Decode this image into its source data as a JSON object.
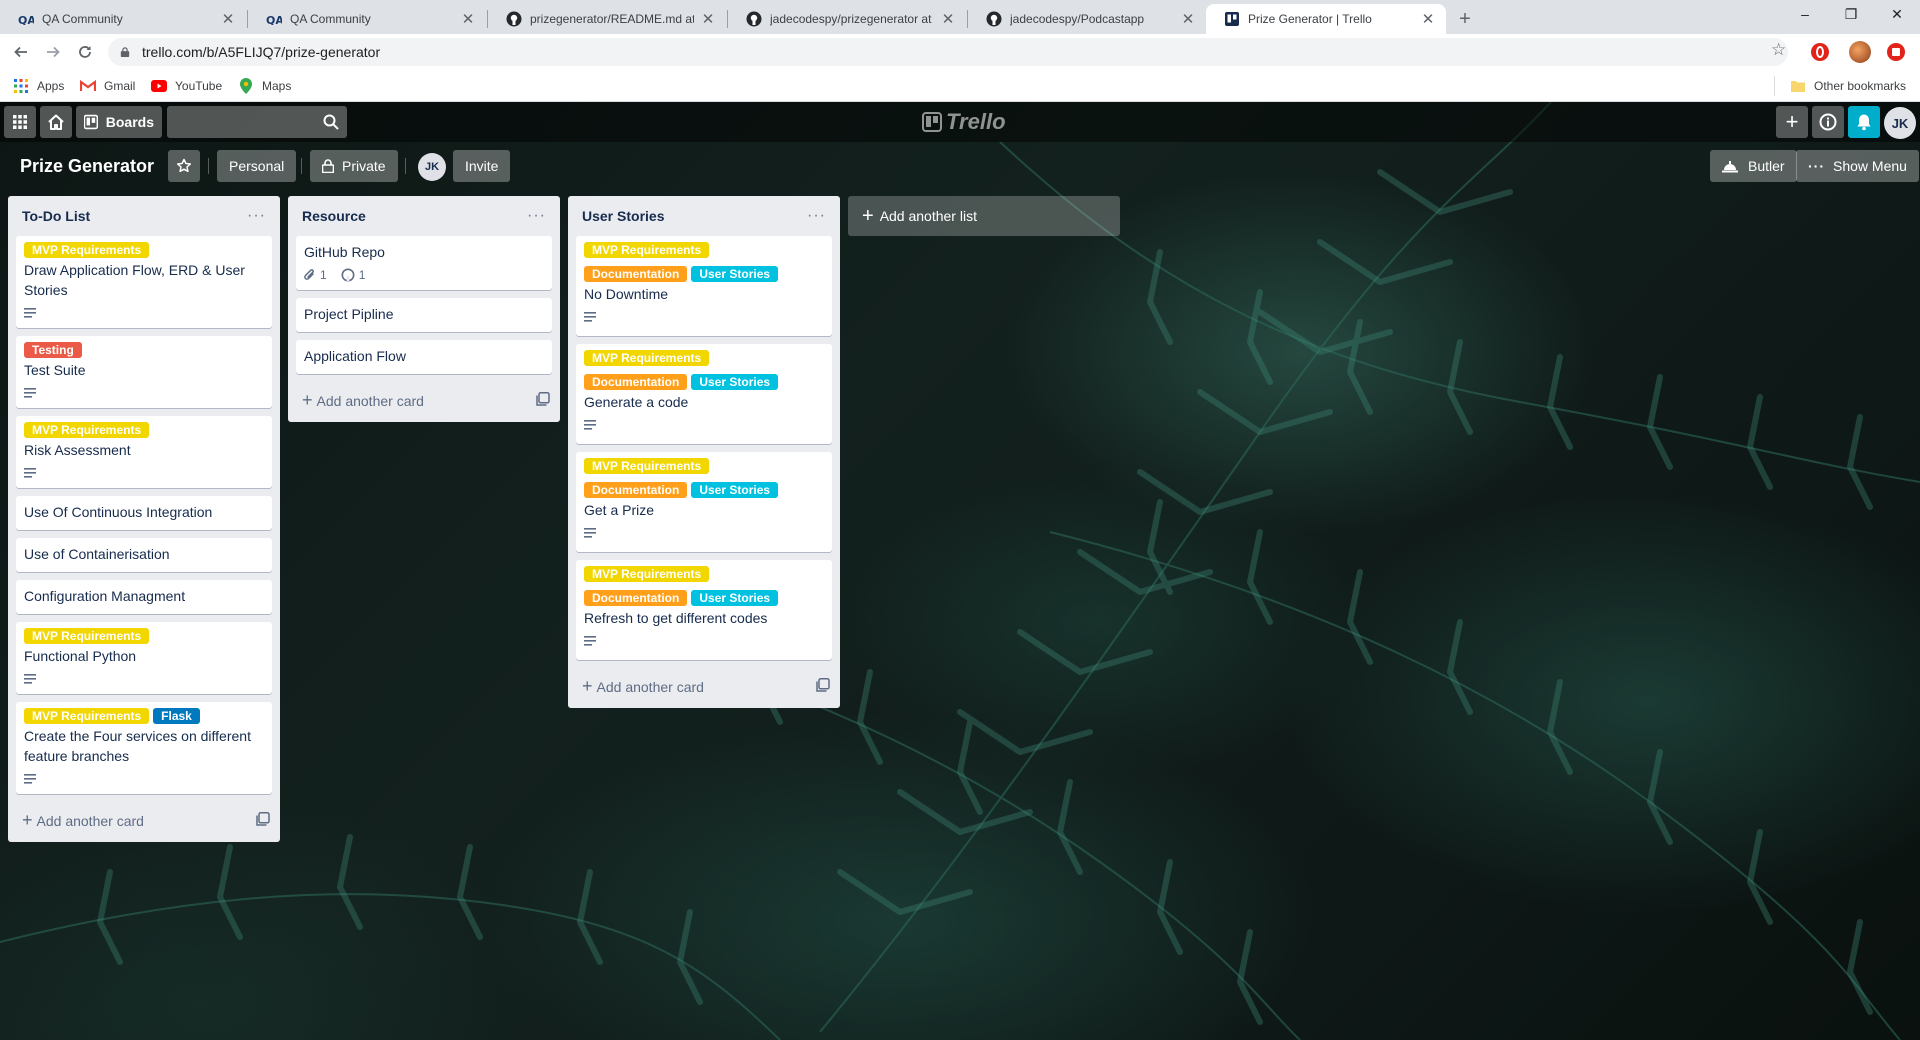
{
  "browser": {
    "tabs": [
      {
        "title": "QA Community",
        "icon": "qa-community-icon",
        "active": false
      },
      {
        "title": "QA Community",
        "icon": "qa-community-icon",
        "active": false
      },
      {
        "title": "prizegenerator/README.md at m",
        "icon": "github-icon",
        "active": false
      },
      {
        "title": "jadecodespy/prizegenerator at c",
        "icon": "github-icon",
        "active": false
      },
      {
        "title": "jadecodespy/Podcastapp",
        "icon": "github-icon",
        "active": false
      },
      {
        "title": "Prize Generator | Trello",
        "icon": "trello-icon",
        "active": true
      }
    ],
    "tab_close": "✕",
    "new_tab": "+",
    "window_controls": {
      "minimize": "–",
      "restore": "❐",
      "close": "✕"
    },
    "url": "trello.com/b/A5FLIJQ7/prize-generator",
    "bookmarks": [
      {
        "label": "Apps",
        "icon": "apps-grid-icon"
      },
      {
        "label": "Gmail",
        "icon": "gmail-icon"
      },
      {
        "label": "YouTube",
        "icon": "youtube-icon"
      },
      {
        "label": "Maps",
        "icon": "maps-pin-icon"
      }
    ],
    "other_bookmarks": "Other bookmarks"
  },
  "header": {
    "boards_label": "Boards",
    "logo_text": "Trello",
    "user_initials": "JK"
  },
  "board": {
    "title": "Prize Generator",
    "visibility_team": "Personal",
    "visibility_privacy": "Private",
    "member_initials": "JK",
    "invite_label": "Invite",
    "butler_label": "Butler",
    "show_menu_label": "Show Menu",
    "add_list_label": "Add another list",
    "add_card_label": "Add another card"
  },
  "label_colors": {
    "yellow": "#f2d600",
    "orange": "#ff9f1a",
    "red": "#eb5a46",
    "sky": "#00c2e0",
    "blue": "#0079bf"
  },
  "lists": [
    {
      "title": "To-Do List",
      "cards": [
        {
          "labels": [
            {
              "text": "MVP Requirements",
              "color": "yellow"
            }
          ],
          "title": "Draw Application Flow, ERD & User Stories",
          "description": true
        },
        {
          "labels": [
            {
              "text": "Testing",
              "color": "red"
            }
          ],
          "title": "Test Suite",
          "description": true
        },
        {
          "labels": [
            {
              "text": "MVP Requirements",
              "color": "yellow"
            }
          ],
          "title": "Risk Assessment",
          "description": true
        },
        {
          "labels": [],
          "title": "Use Of Continuous Integration",
          "description": false
        },
        {
          "labels": [],
          "title": "Use of Containerisation",
          "description": false
        },
        {
          "labels": [],
          "title": "Configuration Managment",
          "description": false
        },
        {
          "labels": [
            {
              "text": "MVP Requirements",
              "color": "yellow"
            }
          ],
          "title": "Functional Python",
          "description": true
        },
        {
          "labels": [
            {
              "text": "MVP Requirements",
              "color": "yellow"
            },
            {
              "text": "Flask",
              "color": "blue"
            }
          ],
          "title": "Create the Four services on different feature branches",
          "description": true
        }
      ]
    },
    {
      "title": "Resource",
      "cards": [
        {
          "labels": [],
          "title": "GitHub Repo",
          "description": false,
          "attachments": "1",
          "github_links": "1"
        },
        {
          "labels": [],
          "title": "Project Pipline",
          "description": false
        },
        {
          "labels": [],
          "title": "Application Flow",
          "description": false
        }
      ]
    },
    {
      "title": "User Stories",
      "cards": [
        {
          "labels": [
            {
              "text": "MVP Requirements",
              "color": "yellow"
            },
            {
              "text": "Documentation",
              "color": "orange"
            },
            {
              "text": "User Stories",
              "color": "sky"
            }
          ],
          "title": "No Downtime",
          "description": true
        },
        {
          "labels": [
            {
              "text": "MVP Requirements",
              "color": "yellow"
            },
            {
              "text": "Documentation",
              "color": "orange"
            },
            {
              "text": "User Stories",
              "color": "sky"
            }
          ],
          "title": "Generate a code",
          "description": true
        },
        {
          "labels": [
            {
              "text": "MVP Requirements",
              "color": "yellow"
            },
            {
              "text": "Documentation",
              "color": "orange"
            },
            {
              "text": "User Stories",
              "color": "sky"
            }
          ],
          "title": "Get a Prize",
          "description": true
        },
        {
          "labels": [
            {
              "text": "MVP Requirements",
              "color": "yellow"
            },
            {
              "text": "Documentation",
              "color": "orange"
            },
            {
              "text": "User Stories",
              "color": "sky"
            }
          ],
          "title": "Refresh to get different codes",
          "description": true
        }
      ]
    }
  ]
}
